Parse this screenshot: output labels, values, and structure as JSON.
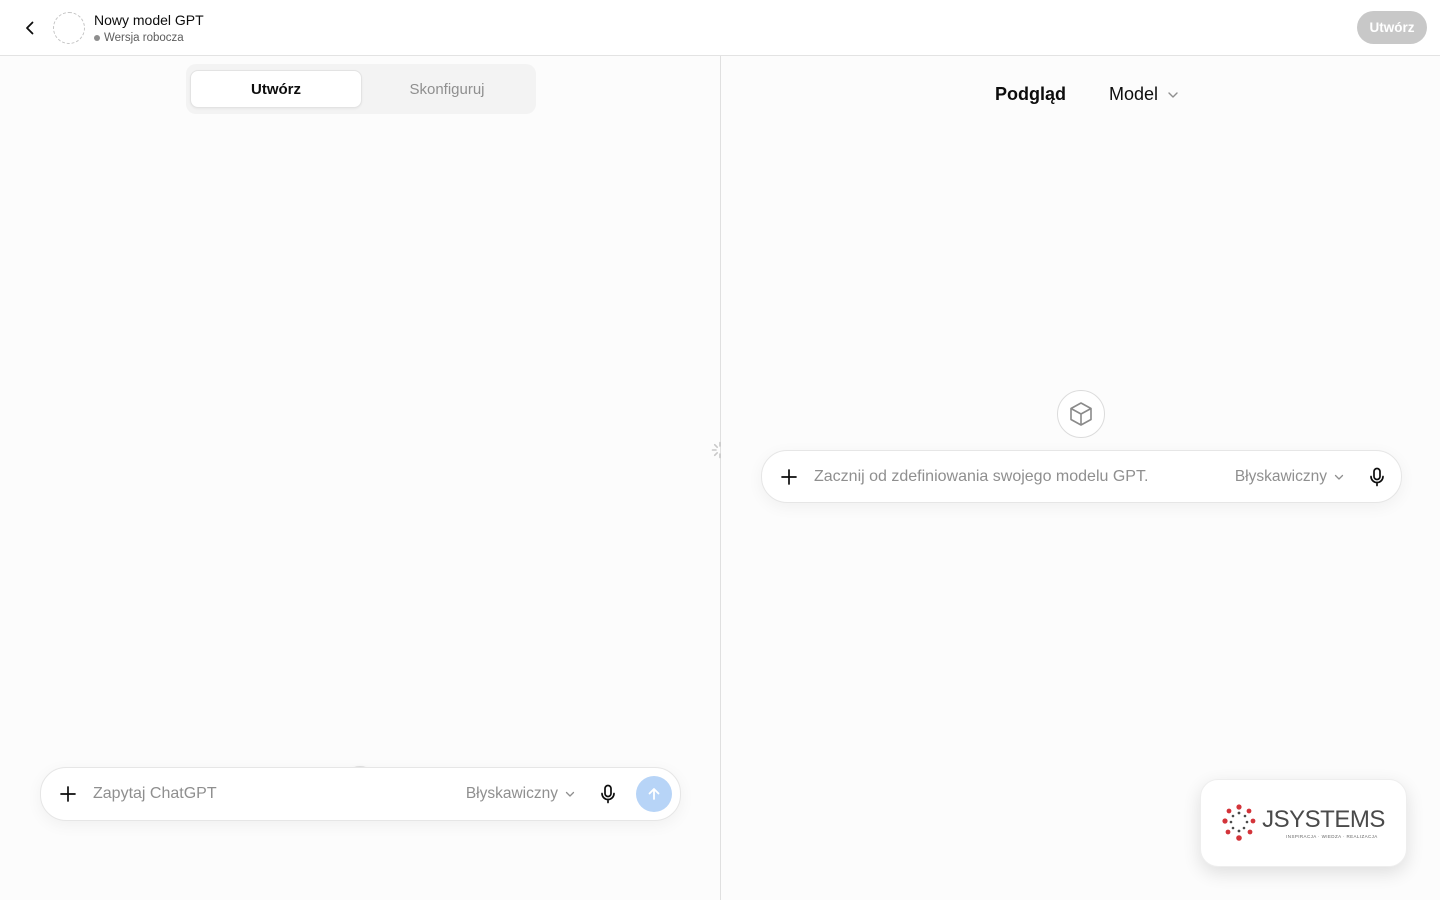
{
  "header": {
    "title": "Nowy model GPT",
    "status": "Wersja robocza",
    "create_label": "Utwórz"
  },
  "left": {
    "tabs": [
      {
        "label": "Utwórz",
        "active": true
      },
      {
        "label": "Skonfiguruj",
        "active": false
      }
    ],
    "composer": {
      "placeholder": "Zapytaj ChatGPT",
      "model": "Błyskawiczny"
    }
  },
  "right": {
    "preview_label": "Podgląd",
    "model_label": "Model",
    "composer": {
      "placeholder": "Zacznij od zdefiniowania swojego modelu GPT.",
      "model": "Błyskawiczny"
    }
  },
  "logo": {
    "brand": "JSYSTEMS",
    "tagline": "INSPIRACJA · WIEDZA · REALIZACJA"
  },
  "colors": {
    "accent_send": "#b7d4f7",
    "logo_red": "#d3343a",
    "logo_gray": "#4a4a4a"
  },
  "icons": [
    "chevron-left-icon",
    "plus-icon",
    "chevron-down-icon",
    "mic-icon",
    "arrow-up-icon",
    "arrow-down-icon",
    "cube-icon",
    "spinner-icon"
  ]
}
